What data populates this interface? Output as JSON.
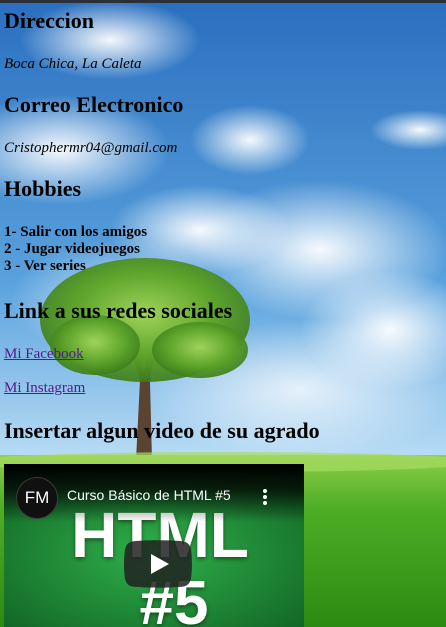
{
  "sections": {
    "direccion": {
      "heading": "Direccion",
      "value": "Boca Chica, La Caleta"
    },
    "correo": {
      "heading": "Correo Electronico",
      "value": "Cristophermr04@gmail.com"
    },
    "hobbies": {
      "heading": "Hobbies",
      "items": [
        "1- Salir con los amigos",
        "2 - Jugar videojuegos",
        "3 - Ver series"
      ]
    },
    "links": {
      "heading": "Link a sus redes sociales",
      "facebook": "Mi Facebook",
      "instagram": "Mi Instagram"
    },
    "video": {
      "heading": "Insertar algun video de su agrado",
      "channel_initials": "FM",
      "title": "Curso Básico de HTML #5",
      "thumbnail_text": "HTML",
      "thumbnail_number": "#5"
    }
  },
  "colors": {
    "sky_top": "#2f78c4",
    "sky_bottom": "#bfe0f6",
    "grass": "#3a9a1f",
    "link_visited": "#551a8b",
    "video_bg": "#1b7a2e"
  },
  "icons": {
    "menu": "kebab-menu-icon",
    "play": "youtube-play-icon"
  }
}
